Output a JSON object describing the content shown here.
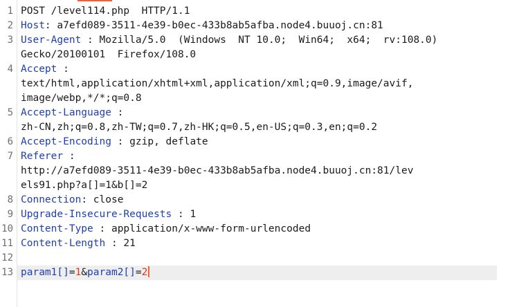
{
  "request": {
    "line_numbers": [
      "1",
      "2",
      "3",
      "4",
      "5",
      "6",
      "7",
      "8",
      "9",
      "10",
      "11",
      "12",
      "13"
    ],
    "request_line": "POST /level114.php  HTTP/1.1",
    "host": {
      "name": "Host",
      "value": " a7efd089-3511-4e39-b0ec-433b8ab5afba.node4.buuoj.cn:81"
    },
    "user_agent": {
      "name": "User-Agent",
      "value": " Mozilla/5.0  (Windows  NT 10.0;  Win64;  x64;  rv:108.0)",
      "value_cont": "Gecko/20100101  Firefox/108.0"
    },
    "accept": {
      "name": "Accept",
      "value_line1": "text/html,application/xhtml+xml,application/xml;q=0.9,image/avif,",
      "value_line2": "image/webp,*/*;q=0.8"
    },
    "accept_language": {
      "name": "Accept-Language",
      "value": "zh-CN,zh;q=0.8,zh-TW;q=0.7,zh-HK;q=0.5,en-US;q=0.3,en;q=0.2"
    },
    "accept_encoding": {
      "name": "Accept-Encoding",
      "value": " gzip, deflate"
    },
    "referer": {
      "name": "Referer",
      "value_line1": "http://a7efd089-3511-4e39-b0ec-433b8ab5afba.node4.buuoj.cn:81/lev",
      "value_line2": "els91.php?a[]=1&b[]=2"
    },
    "connection": {
      "name": "Connection",
      "value": " close"
    },
    "upgrade_insecure": {
      "name": "Upgrade-Insecure-Requests",
      "value": " 1"
    },
    "content_type": {
      "name": "Content-Type",
      "value": " application/x-www-form-urlencoded"
    },
    "content_length": {
      "name": "Content-Length",
      "value": " 21"
    },
    "body": {
      "param1_name": "param1[]",
      "param1_eq": "=",
      "param1_value": "1",
      "amp": "&",
      "param2_name": "param2[]",
      "param2_eq": "=",
      "param2_value": "2"
    },
    "colon": " :",
    "colon_tight": ":"
  },
  "colors": {
    "header_name": "#1f3fb0",
    "param_value": "#d23c1e",
    "cursor": "#e8643c",
    "active_line": "#eeeeee"
  }
}
